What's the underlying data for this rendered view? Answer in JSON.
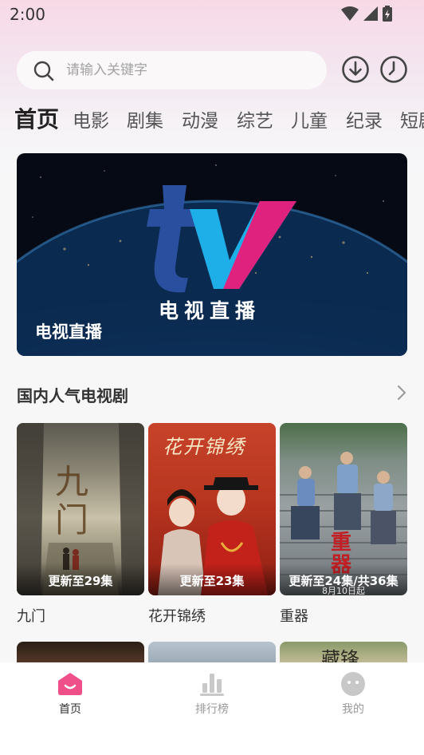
{
  "status_bar": {
    "time": "2:00"
  },
  "search": {
    "placeholder": "请输入关键字"
  },
  "tabs": [
    {
      "label": "首页",
      "active": true
    },
    {
      "label": "电影"
    },
    {
      "label": "剧集"
    },
    {
      "label": "动漫"
    },
    {
      "label": "综艺"
    },
    {
      "label": "儿童"
    },
    {
      "label": "纪录"
    },
    {
      "label": "短剧"
    }
  ],
  "banner": {
    "logo_text": "电视直播",
    "title": "电视直播"
  },
  "section": {
    "title": "国内人气电视剧"
  },
  "cards": [
    {
      "title": "九门",
      "badge": "更新至29集",
      "poster_text": "九门"
    },
    {
      "title": "花开锦绣",
      "badge": "更新至23集",
      "poster_text": "花开锦绣"
    },
    {
      "title": "重器",
      "badge": "更新至24集/共36集",
      "poster_text": "重器",
      "poster_subtext": "8月10日起"
    }
  ],
  "row2_posters": [
    {
      "poster_text": ""
    },
    {
      "poster_text": ""
    },
    {
      "poster_text": "藏锋"
    }
  ],
  "bottom_nav": [
    {
      "label": "首页",
      "icon": "home-icon",
      "active": true
    },
    {
      "label": "排行榜",
      "icon": "ranking-icon"
    },
    {
      "label": "我的",
      "icon": "profile-icon"
    }
  ],
  "colors": {
    "accent": "#f0508a",
    "inactive": "#c8c8c8"
  }
}
